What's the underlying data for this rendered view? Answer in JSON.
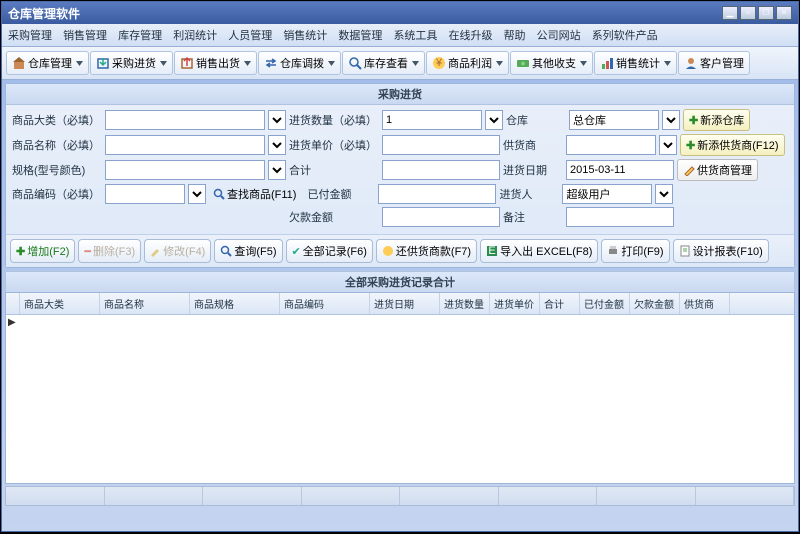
{
  "title": "仓库管理软件",
  "menu": [
    "采购管理",
    "销售管理",
    "库存管理",
    "利润统计",
    "人员管理",
    "销售统计",
    "数据管理",
    "系统工具",
    "在线升级",
    "帮助",
    "公司网站",
    "系列软件产品"
  ],
  "toolbar": [
    {
      "label": "仓库管理",
      "ico": "home"
    },
    {
      "label": "采购进货",
      "ico": "in"
    },
    {
      "label": "销售出货",
      "ico": "out"
    },
    {
      "label": "仓库调拨",
      "ico": "move"
    },
    {
      "label": "库存查看",
      "ico": "view"
    },
    {
      "label": "商品利润",
      "ico": "profit"
    },
    {
      "label": "其他收支",
      "ico": "money"
    },
    {
      "label": "销售统计",
      "ico": "stat"
    },
    {
      "label": "客户管理",
      "ico": "cust"
    }
  ],
  "panel_title": "采购进货",
  "form": {
    "cat_label": "商品大类（必填）",
    "name_label": "商品名称（必填）",
    "spec_label": "规格(型号颜色)",
    "code_label": "商品编码（必填）",
    "qty_label": "进货数量（必填）",
    "qty_value": "1",
    "price_label": "进货单价（必填）",
    "total_label": "合计",
    "paid_label": "已付金额",
    "owed_label": "欠款金额",
    "warehouse_label": "仓库",
    "warehouse_value": "总仓库",
    "supplier_label": "供货商",
    "date_label": "进货日期",
    "date_value": "2015-03-11",
    "person_label": "进货人",
    "person_value": "超级用户",
    "remark_label": "备注",
    "search_btn": "查找商品(F11)",
    "add_wh": "新添仓库",
    "add_supplier": "新添供货商(F12)",
    "mgr_supplier": "供货商管理"
  },
  "actions": {
    "add": "增加(F2)",
    "del": "删除(F3)",
    "edit": "修改(F4)",
    "query": "查询(F5)",
    "all": "全部记录(F6)",
    "repay": "还供货商款(F7)",
    "export": "导入出 EXCEL(F8)",
    "print": "打印(F9)",
    "design": "设计报表(F10)"
  },
  "grid_title": "全部采购进货记录合计",
  "columns": [
    "商品大类",
    "商品名称",
    "商品规格",
    "商品编码",
    "进货日期",
    "进货数量",
    "进货单价",
    "合计",
    "已付金额",
    "欠款金额",
    "供货商"
  ]
}
